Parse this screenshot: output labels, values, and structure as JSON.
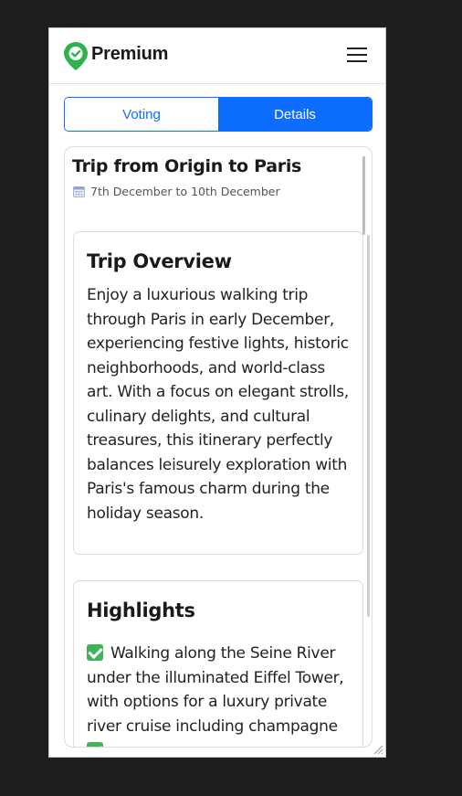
{
  "app": {
    "brand": "Premium"
  },
  "colors": {
    "accent": "#0d6efd",
    "brand_green": "#2fb24c",
    "check_green": "#3db45a"
  },
  "icons": {
    "logo": "location-pin-check-icon",
    "menu": "hamburger-menu-icon",
    "calendar": "calendar-icon",
    "check": "check-mark-icon"
  },
  "tabs": [
    {
      "label": "Voting",
      "active": false
    },
    {
      "label": "Details",
      "active": true
    }
  ],
  "trip": {
    "title": "Trip from Origin to Paris",
    "dates": "7th December to 10th December"
  },
  "overview": {
    "title": "Trip Overview",
    "body": "Enjoy a luxurious walking trip through Paris in early December, experiencing festive lights, historic neighborhoods, and world-class art. With a focus on elegant strolls, culinary delights, and cultural treasures, this itinerary perfectly balances leisurely exploration with Paris's famous charm during the holiday season."
  },
  "highlights": {
    "title": "Highlights",
    "items": [
      "Walking along the Seine River under the illuminated Eiffel Tower, with options for a luxury private river cruise including champagne"
    ]
  }
}
